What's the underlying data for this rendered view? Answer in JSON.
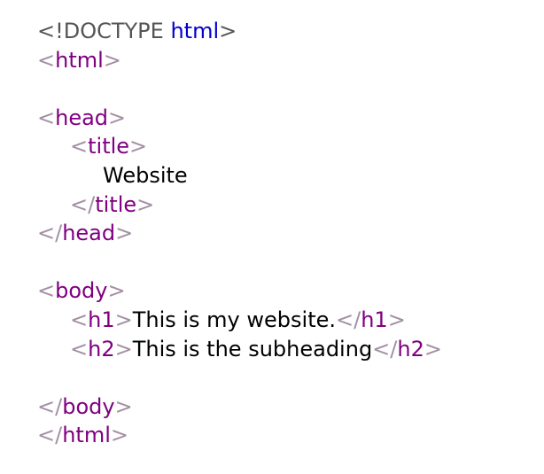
{
  "colors": {
    "bracket": "#a38fa3",
    "tag": "#800080",
    "doctype": "#555555",
    "keyword": "#0000cd",
    "text": "#000000"
  },
  "lines": [
    {
      "indent": 0,
      "tokens": [
        {
          "t": "doctype",
          "v": "<!DOCTYPE "
        },
        {
          "t": "keyword",
          "v": "html"
        },
        {
          "t": "doctype",
          "v": ">"
        }
      ]
    },
    {
      "indent": 0,
      "tokens": [
        {
          "t": "bracket",
          "v": "<"
        },
        {
          "t": "tag",
          "v": "html"
        },
        {
          "t": "bracket",
          "v": ">"
        }
      ]
    },
    {
      "indent": 0,
      "tokens": []
    },
    {
      "indent": 0,
      "tokens": [
        {
          "t": "bracket",
          "v": "<"
        },
        {
          "t": "tag",
          "v": "head"
        },
        {
          "t": "bracket",
          "v": ">"
        }
      ]
    },
    {
      "indent": 1,
      "tokens": [
        {
          "t": "bracket",
          "v": "<"
        },
        {
          "t": "tag",
          "v": "title"
        },
        {
          "t": "bracket",
          "v": ">"
        }
      ]
    },
    {
      "indent": 2,
      "tokens": [
        {
          "t": "text",
          "v": "Website"
        }
      ]
    },
    {
      "indent": 1,
      "tokens": [
        {
          "t": "bracket",
          "v": "</"
        },
        {
          "t": "tag",
          "v": "title"
        },
        {
          "t": "bracket",
          "v": ">"
        }
      ]
    },
    {
      "indent": 0,
      "tokens": [
        {
          "t": "bracket",
          "v": "</"
        },
        {
          "t": "tag",
          "v": "head"
        },
        {
          "t": "bracket",
          "v": ">"
        }
      ]
    },
    {
      "indent": 0,
      "tokens": []
    },
    {
      "indent": 0,
      "tokens": [
        {
          "t": "bracket",
          "v": "<"
        },
        {
          "t": "tag",
          "v": "body"
        },
        {
          "t": "bracket",
          "v": ">"
        }
      ]
    },
    {
      "indent": 1,
      "tokens": [
        {
          "t": "bracket",
          "v": "<"
        },
        {
          "t": "tag",
          "v": "h1"
        },
        {
          "t": "bracket",
          "v": ">"
        },
        {
          "t": "text",
          "v": "This is my website."
        },
        {
          "t": "bracket",
          "v": "</"
        },
        {
          "t": "tag",
          "v": "h1"
        },
        {
          "t": "bracket",
          "v": ">"
        }
      ]
    },
    {
      "indent": 1,
      "tokens": [
        {
          "t": "bracket",
          "v": "<"
        },
        {
          "t": "tag",
          "v": "h2"
        },
        {
          "t": "bracket",
          "v": ">"
        },
        {
          "t": "text",
          "v": "This is the subheading"
        },
        {
          "t": "bracket",
          "v": "</"
        },
        {
          "t": "tag",
          "v": "h2"
        },
        {
          "t": "bracket",
          "v": ">"
        }
      ]
    },
    {
      "indent": 0,
      "tokens": []
    },
    {
      "indent": 0,
      "tokens": [
        {
          "t": "bracket",
          "v": "</"
        },
        {
          "t": "tag",
          "v": "body"
        },
        {
          "t": "bracket",
          "v": ">"
        }
      ]
    },
    {
      "indent": 0,
      "tokens": [
        {
          "t": "bracket",
          "v": "</"
        },
        {
          "t": "tag",
          "v": "html"
        },
        {
          "t": "bracket",
          "v": ">"
        }
      ]
    }
  ]
}
